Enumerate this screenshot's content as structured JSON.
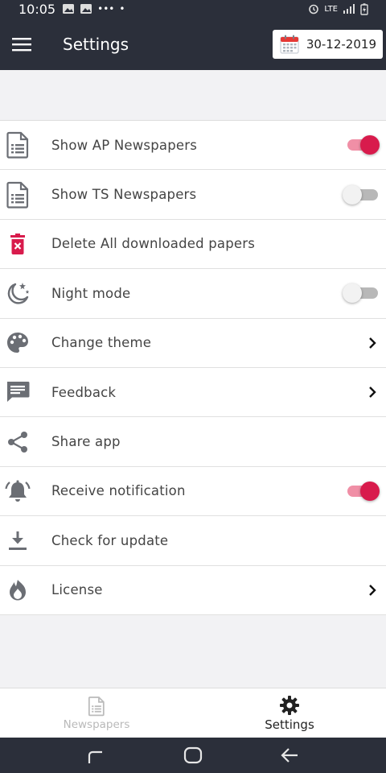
{
  "status_bar": {
    "time": "10:05",
    "dots": "•••",
    "dot": "•",
    "network": "LTE"
  },
  "app_bar": {
    "title": "Settings",
    "date": "30-12-2019"
  },
  "settings": [
    {
      "label": "Show AP Newspapers",
      "icon": "newspaper-icon",
      "trailing": "toggle",
      "enabled": true
    },
    {
      "label": "Show TS Newspapers",
      "icon": "newspaper-icon",
      "trailing": "toggle",
      "enabled": false
    },
    {
      "label": "Delete All downloaded papers",
      "icon": "delete-icon",
      "trailing": "none"
    },
    {
      "label": "Night mode",
      "icon": "night-mode-icon",
      "trailing": "toggle",
      "enabled": false
    },
    {
      "label": "Change theme",
      "icon": "palette-icon",
      "trailing": "chevron"
    },
    {
      "label": "Feedback",
      "icon": "feedback-icon",
      "trailing": "chevron"
    },
    {
      "label": "Share app",
      "icon": "share-icon",
      "trailing": "none"
    },
    {
      "label": "Receive notification",
      "icon": "bell-icon",
      "trailing": "toggle",
      "enabled": true
    },
    {
      "label": "Check for update",
      "icon": "download-icon",
      "trailing": "none"
    },
    {
      "label": "License",
      "icon": "license-icon",
      "trailing": "chevron"
    }
  ],
  "bottom_nav": [
    {
      "label": "Newspapers",
      "icon": "newspaper-icon",
      "active": false
    },
    {
      "label": "Settings",
      "icon": "gear-icon",
      "active": true
    }
  ],
  "colors": {
    "appbar": "#2b2f3a",
    "accent": "#d81b4c",
    "icon": "#6b6e74",
    "text": "#444444"
  }
}
